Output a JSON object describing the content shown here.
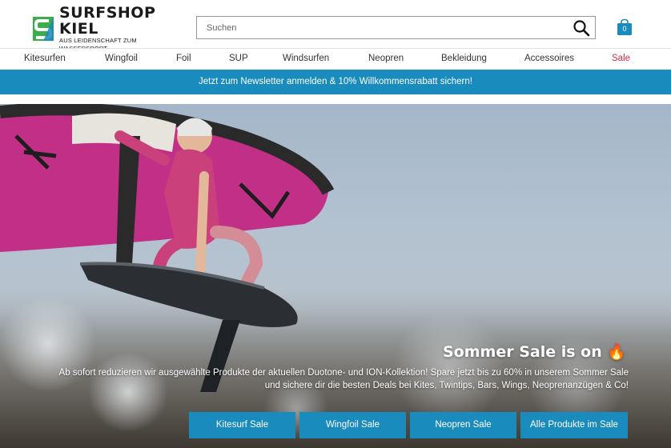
{
  "brand": {
    "name": "SURFSHOP KIEL",
    "tagline": "AUS LEIDENSCHAFT ZUM WASSERSPORT",
    "colors": {
      "green": "#3cae49",
      "blue": "#1a8bbd"
    }
  },
  "search": {
    "placeholder": "Suchen",
    "value": ""
  },
  "cart": {
    "count": "0"
  },
  "nav": {
    "items": [
      {
        "label": "Kitesurfen"
      },
      {
        "label": "Wingfoil"
      },
      {
        "label": "Foil"
      },
      {
        "label": "SUP"
      },
      {
        "label": "Windsurfen"
      },
      {
        "label": "Neopren"
      },
      {
        "label": "Bekleidung"
      },
      {
        "label": "Accessoires"
      },
      {
        "label": "Sale"
      }
    ],
    "sale_color": "#d6304a"
  },
  "newsletter_banner": {
    "text": "Jetzt zum Newsletter anmelden & 10% Willkommensrabatt sichern!"
  },
  "hero": {
    "title": "Sommer Sale is on 🔥",
    "text": "Ab sofort reduzieren wir ausgewählte Produkte der aktuellen Duotone- und ION-Kollektion! Spare jetzt bis zu 60% in unserem Sommer Sale und sichere dir die besten Deals bei Kites, Twintips, Bars, Wings, Neoprenanzügen & Co!",
    "buttons": [
      {
        "label": "Kitesurf Sale"
      },
      {
        "label": "Wingfoil Sale"
      },
      {
        "label": "Neopren Sale"
      },
      {
        "label": "Alle Produkte im Sale"
      }
    ]
  }
}
